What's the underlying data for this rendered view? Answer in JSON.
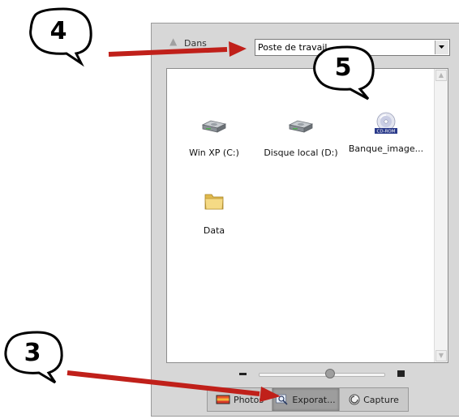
{
  "location": {
    "label": "Dans",
    "selected": "Poste de travail"
  },
  "items": [
    {
      "label": "Win XP (C:)",
      "icon": "hard-drive-icon"
    },
    {
      "label": "Disque local (D:)",
      "icon": "hard-drive-icon"
    },
    {
      "label": "Banque_image...",
      "icon": "cd-rom-icon",
      "badge": "CD-ROM"
    },
    {
      "label": "Data",
      "icon": "folder-icon"
    }
  ],
  "slider": {
    "value_fraction": 0.5
  },
  "tabs": [
    {
      "label": "Photos",
      "icon": "photos-icon",
      "active": false
    },
    {
      "label": "Exporat...",
      "icon": "magnifier-icon",
      "active": true
    },
    {
      "label": "Capture",
      "icon": "capture-icon",
      "active": false
    }
  ],
  "callouts": [
    {
      "number": "4"
    },
    {
      "number": "5"
    },
    {
      "number": "3"
    }
  ],
  "colors": {
    "arrow": "#c0201a",
    "panel": "#d7d7d7",
    "folder": "#f2d37a"
  }
}
